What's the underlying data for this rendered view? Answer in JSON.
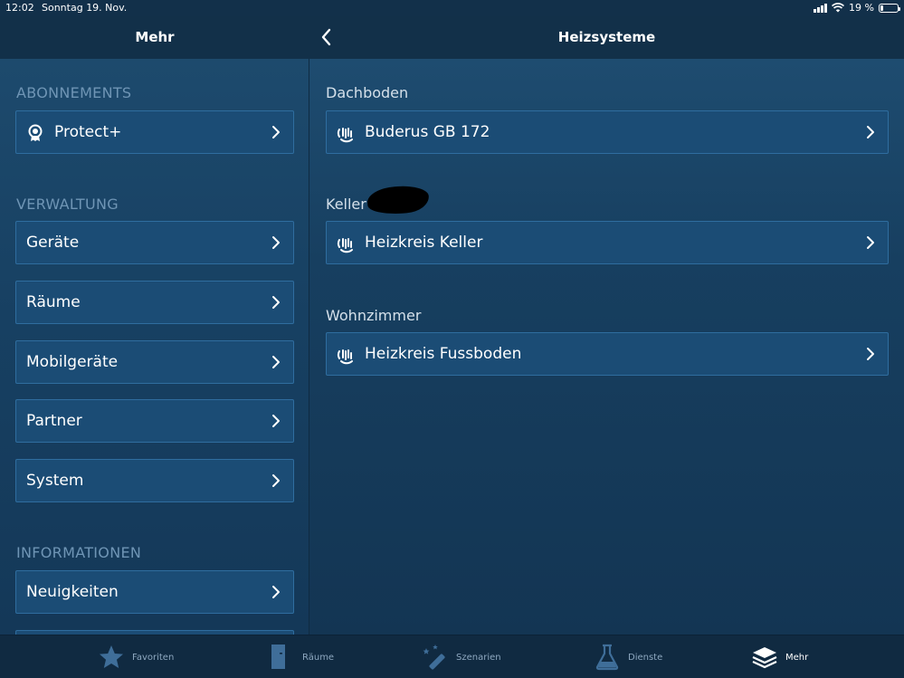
{
  "status_bar": {
    "time": "12:02",
    "date": "Sonntag 19. Nov.",
    "battery": "19 %",
    "battery_level": 0.19
  },
  "nav": {
    "left_title": "Mehr",
    "right_title": "Heizsysteme"
  },
  "sidebar": {
    "sections": [
      {
        "header": "ABONNEMENTS",
        "items": [
          {
            "label": "Protect+",
            "icon": "award-badge-icon"
          }
        ]
      },
      {
        "header": "VERWALTUNG",
        "items": [
          {
            "label": "Geräte"
          },
          {
            "label": "Räume"
          },
          {
            "label": "Mobilgeräte"
          },
          {
            "label": "Partner"
          },
          {
            "label": "System"
          }
        ]
      },
      {
        "header": "INFORMATIONEN",
        "items": [
          {
            "label": "Neuigkeiten"
          }
        ]
      }
    ]
  },
  "heating": {
    "groups": [
      {
        "room": "Dachboden",
        "device": "Buderus GB 172",
        "icon": "heating-system-icon"
      },
      {
        "room": "Keller",
        "device": "Heizkreis Keller",
        "icon": "heating-system-icon"
      },
      {
        "room": "Wohnzimmer",
        "device": "Heizkreis Fussboden",
        "icon": "heating-system-icon"
      }
    ]
  },
  "tabs": [
    {
      "label": "Favoriten",
      "icon": "star-icon",
      "active": false
    },
    {
      "label": "Räume",
      "icon": "door-icon",
      "active": false
    },
    {
      "label": "Szenarien",
      "icon": "magic-wand-icon",
      "active": false
    },
    {
      "label": "Dienste",
      "icon": "flask-icon",
      "active": false
    },
    {
      "label": "Mehr",
      "icon": "layers-icon",
      "active": true
    }
  ],
  "colors": {
    "background": "#16354f",
    "row_fill": "#1b4c75",
    "row_border": "#2f6d9f",
    "section_header": "#6f95b5",
    "tab_inactive": "#8ea8c0"
  }
}
